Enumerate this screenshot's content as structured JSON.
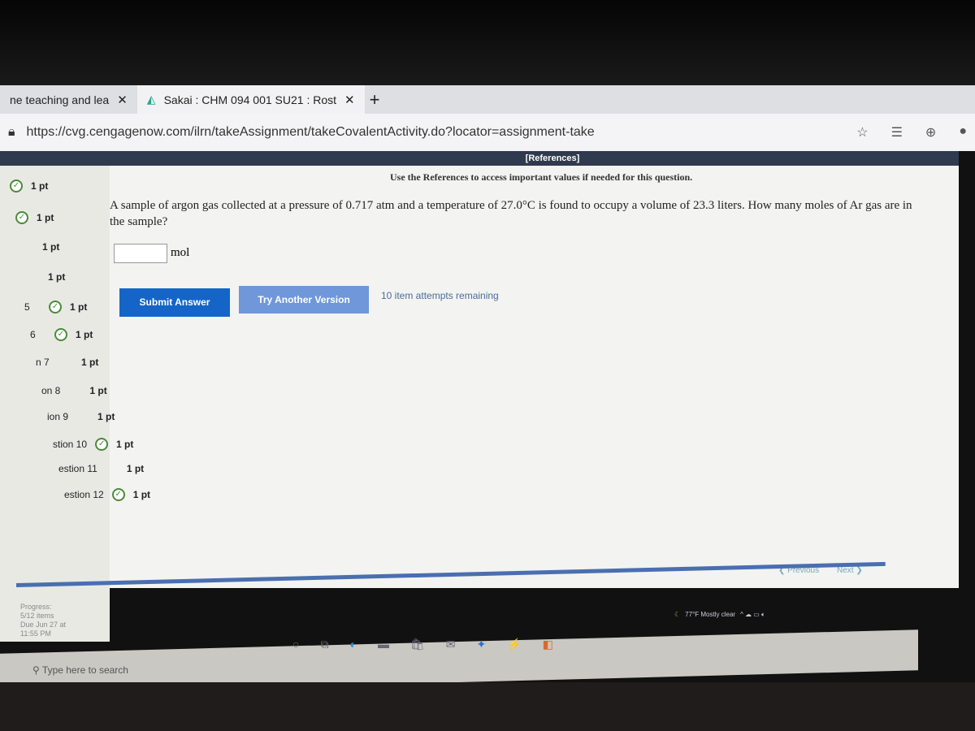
{
  "browser": {
    "tabs": [
      {
        "label": "ne teaching and lea"
      },
      {
        "label": "Sakai : CHM 094 001 SU21 : Rost"
      }
    ],
    "new_tab": "+",
    "url": "https://cvg.cengagenow.com/ilrn/takeAssignment/takeCovalentActivity.do?locator=assignment-take"
  },
  "references": "[References]",
  "hint": "Use the References to access important values if needed for this question.",
  "question": "A sample of argon gas collected at a pressure of 0.717 atm and a temperature of 27.0°C is found to occupy a volume of 23.3 liters. How many moles of Ar gas are in the sample?",
  "answer": {
    "value": "",
    "unit": "mol"
  },
  "buttons": {
    "submit": "Submit Answer",
    "try_another": "Try Another Version"
  },
  "attempts": "10 item attempts remaining",
  "nav": {
    "previous": "Previous",
    "next": "Next"
  },
  "sidebar": {
    "items": [
      {
        "label": "",
        "points": "1 pt",
        "done": true
      },
      {
        "label": "",
        "points": "1 pt",
        "done": true
      },
      {
        "label": "",
        "points": "1 pt",
        "done": false
      },
      {
        "label": "",
        "points": "1 pt",
        "done": false
      },
      {
        "label": "5",
        "points": "1 pt",
        "done": true
      },
      {
        "label": "6",
        "points": "1 pt",
        "done": true
      },
      {
        "label": "n 7",
        "points": "1 pt",
        "done": false
      },
      {
        "label": "on 8",
        "points": "1 pt",
        "done": false
      },
      {
        "label": "ion 9",
        "points": "1 pt",
        "done": false
      },
      {
        "label": "stion 10",
        "points": "1 pt",
        "done": true
      },
      {
        "label": "estion 11",
        "points": "1 pt",
        "done": false
      },
      {
        "label": "estion 12",
        "points": "1 pt",
        "done": true
      }
    ],
    "progress": [
      "Progress:",
      "5/12 items",
      "Due Jun 27 at",
      "11:55 PM"
    ]
  },
  "taskbar": {
    "search_placeholder": "Type here to search",
    "weather": "77°F Mostly clear"
  }
}
